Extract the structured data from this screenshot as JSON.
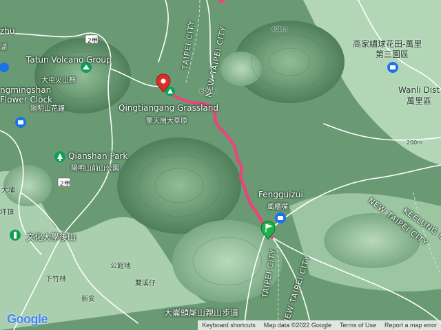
{
  "colors": {
    "terrain_light": "#a9cfae",
    "terrain_mid": "#7fae88",
    "terrain_dark": "#5c8c66",
    "route": "#e8457a",
    "road": "#ffffff",
    "poi_blue": "#1a73e8",
    "poi_green": "#0f9d58",
    "start_marker": "#1db34a",
    "end_marker": "#d93025"
  },
  "labels": {
    "taipei_city_top": "TAIPEI CITY",
    "new_taipei_city_top": "NEW TAIPEI CITY",
    "taipei_city_bottom": "TAIPEI CITY",
    "new_taipei_city_bottom": "NEW TAIPEI CITY",
    "new_taipei_city_right": "NEW TAIPEI CITY",
    "keelung_city": "KEELUNG CITY",
    "tatun_en": "Tatun Volcano Group",
    "tatun_zh": "大屯火山群",
    "zhu_en": "zhu",
    "zhu_zh": "湖",
    "flower_clock_en": "ngmingshan Flower Clock",
    "flower_clock_zh": "陽明山花鐘",
    "qingtiangang_en": "Qingtiangang Grassland",
    "qingtiangang_zh": "擎天崗大草原",
    "qianshan_en": "Qianshan Park",
    "qianshan_zh": "陽明山前山公園",
    "fengguizui_en": "Fengguizui",
    "fengguizui_zh": "風櫃嘴",
    "gao_en": "高家繡球花田-萬里",
    "gao_zh": "第三園區",
    "wanli_en": "Wanli Dist",
    "wanli_zh": "萬里區",
    "culture_univ": "文化大學後山",
    "dapu": "大埔",
    "pinggang": "坪頂",
    "xiazhulin": "下竹林",
    "gongguandi": "公館地",
    "shuangxizai": "雙溪仔",
    "xinan": "新安",
    "trail": "大崙頭尾山親山步道",
    "road_2a": "2甲",
    "road_2a_b": "2甲",
    "elev_400": "400m",
    "elev_600": "600m",
    "elev_200": "200m"
  },
  "footer": {
    "google": "Google",
    "shortcuts": "Keyboard shortcuts",
    "mapdata": "Map data ©2022 Google",
    "terms": "Terms of Use",
    "report": "Report a map error"
  }
}
